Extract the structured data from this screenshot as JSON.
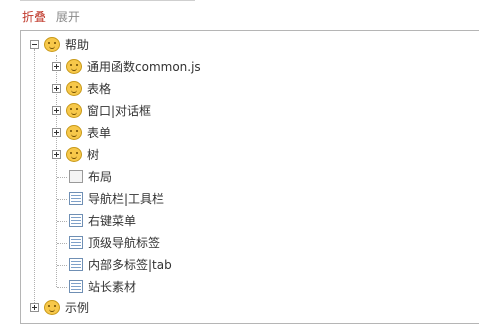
{
  "toolbar": {
    "collapse_label": "折叠",
    "expand_label": "展开"
  },
  "tree": {
    "root": {
      "label": "帮助",
      "icon": "smiley-folder-icon"
    },
    "groups": [
      {
        "label": "通用函数common.js",
        "icon": "smiley-folder-icon"
      },
      {
        "label": "表格",
        "icon": "smiley-folder-icon"
      },
      {
        "label": "窗口|对话框",
        "icon": "smiley-folder-icon"
      },
      {
        "label": "表单",
        "icon": "smiley-folder-icon"
      },
      {
        "label": "树",
        "icon": "smiley-folder-icon"
      }
    ],
    "leaves": [
      {
        "label": "布局",
        "icon": "blank-page-icon"
      },
      {
        "label": "导航栏|工具栏",
        "icon": "list-page-icon"
      },
      {
        "label": "右键菜单",
        "icon": "list-page-icon"
      },
      {
        "label": "顶级导航标签",
        "icon": "list-page-icon"
      },
      {
        "label": "内部多标签|tab",
        "icon": "list-page-icon"
      },
      {
        "label": "站长素材",
        "icon": "list-page-icon"
      }
    ],
    "second_root": {
      "label": "示例",
      "icon": "smiley-folder-icon"
    }
  }
}
